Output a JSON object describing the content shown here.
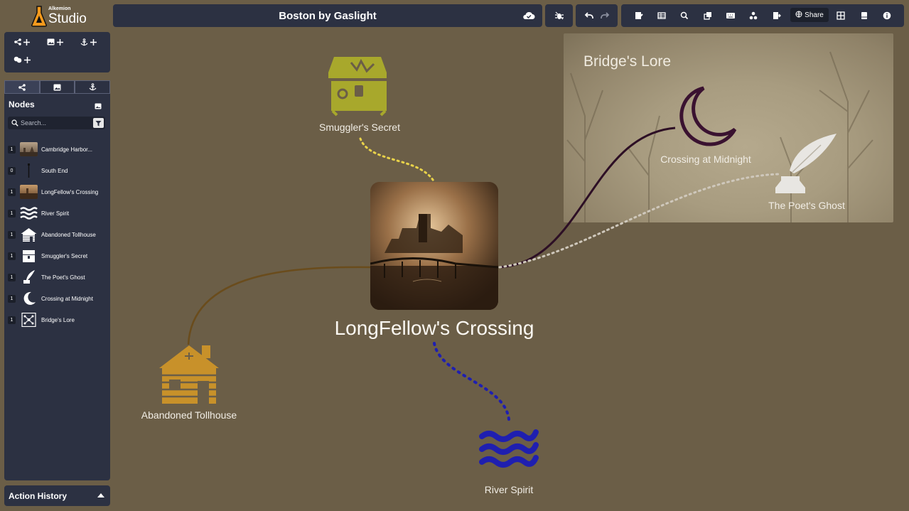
{
  "app": {
    "logo_small": "Alkemion",
    "logo_big": "Studio"
  },
  "header": {
    "title": "Boston by Gaslight",
    "share_label": "Share"
  },
  "sidebar": {
    "nodes_title": "Nodes",
    "search_placeholder": "Search...",
    "items": [
      {
        "count": "1",
        "label": "Cambridge Harbor...",
        "icon": "harbor-thumbnail"
      },
      {
        "count": "0",
        "label": "South End",
        "icon": "lamp-post-icon"
      },
      {
        "count": "1",
        "label": "LongFellow's Crossing",
        "icon": "crossing-thumbnail"
      },
      {
        "count": "1",
        "label": "River Spirit",
        "icon": "waves-icon"
      },
      {
        "count": "1",
        "label": "Abandoned Tollhouse",
        "icon": "cabin-icon"
      },
      {
        "count": "1",
        "label": "Smuggler's Secret",
        "icon": "treasure-chest-icon"
      },
      {
        "count": "1",
        "label": "The Poet's Ghost",
        "icon": "quill-inkwell-icon"
      },
      {
        "count": "1",
        "label": "Crossing at Midnight",
        "icon": "crescent-moon-icon"
      },
      {
        "count": "1",
        "label": "Bridge's Lore",
        "icon": "network-icon"
      }
    ],
    "history_label": "Action History"
  },
  "canvas": {
    "region_title": "Bridge's Lore",
    "central_label": "LongFellow's Crossing",
    "nodes": {
      "smuggler": "Smuggler's Secret",
      "midnight": "Crossing at Midnight",
      "poet": "The Poet's Ghost",
      "tollhouse": "Abandoned Tollhouse",
      "river": "River Spirit"
    },
    "colors": {
      "smuggler": "#a8a82c",
      "midnight": "#3a1230",
      "poet": "#e8e6e2",
      "tollhouse": "#c8912a",
      "river": "#1f1fb0"
    }
  }
}
